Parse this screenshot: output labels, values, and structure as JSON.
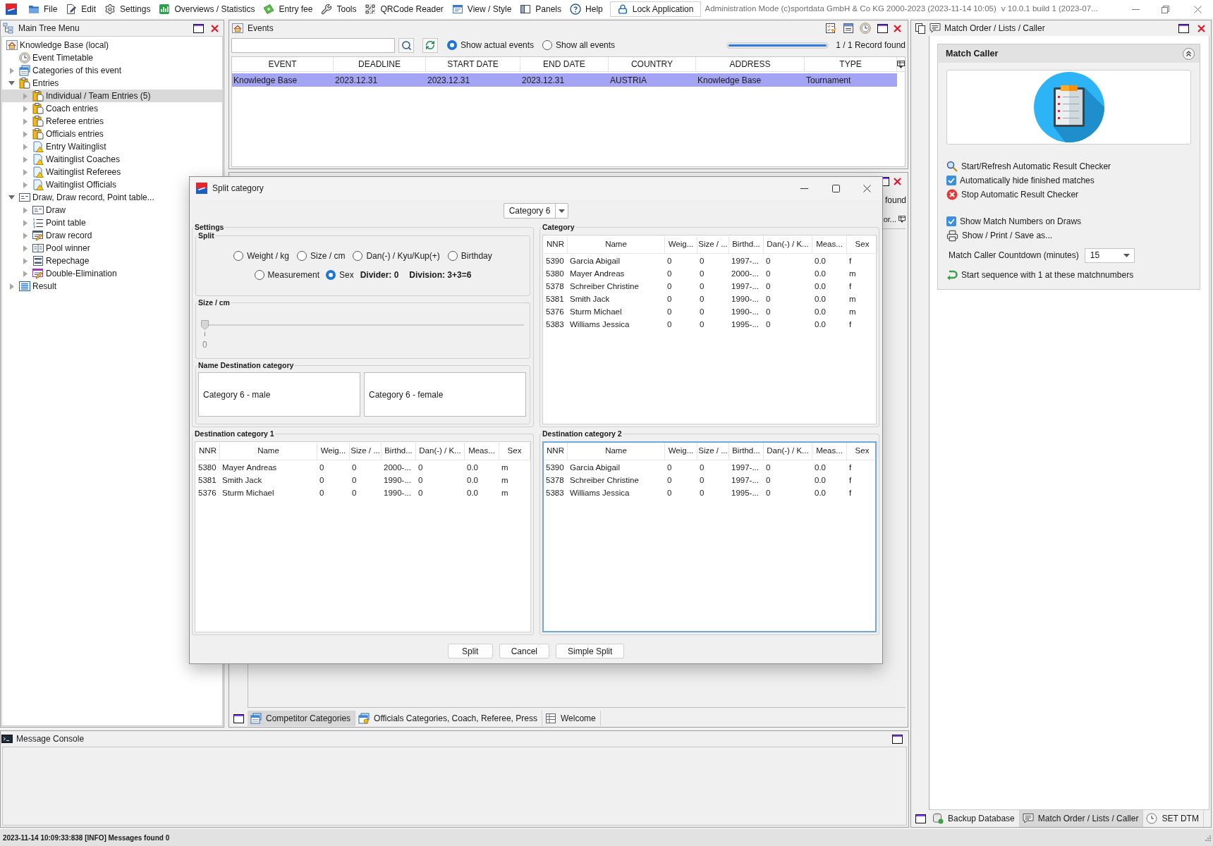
{
  "menu_bar": {
    "items": [
      "File",
      "Edit",
      "Settings",
      "Overviews / Statistics",
      "Entry fee",
      "Tools",
      "QRCode Reader",
      "View / Style",
      "Panels",
      "Help"
    ],
    "lock_button": "Lock Application",
    "title": "Administration Mode (c)sportdata GmbH & Co KG 2000-2023 (2023-11-14 10:05)",
    "version": "v 10.0.1 build 1 (2023-07..."
  },
  "tree_panel": {
    "title": "Main Tree Menu",
    "items": [
      {
        "label": "Knowledge Base (local)",
        "kind": "home",
        "selected": false,
        "children": [
          {
            "label": "Event Timetable",
            "kind": "clock",
            "selected": false
          },
          {
            "label": "Categories of this event",
            "kind": "categories",
            "selected": false,
            "expanded": false
          },
          {
            "label": "Entries",
            "kind": "entries",
            "selected": false,
            "expanded": true,
            "children": [
              {
                "label": "Individual / Team Entries (5)",
                "kind": "entries",
                "selected": true,
                "expanded": false
              },
              {
                "label": "Coach entries",
                "kind": "entries",
                "selected": false,
                "expanded": false
              },
              {
                "label": "Referee entries",
                "kind": "entries",
                "selected": false,
                "expanded": false
              },
              {
                "label": "Officials entries",
                "kind": "entries",
                "selected": false,
                "expanded": false
              },
              {
                "label": "Entry Waitinglist",
                "kind": "waitinglist",
                "selected": false,
                "expanded": false
              },
              {
                "label": "Waitinglist Coaches",
                "kind": "waitinglist",
                "selected": false,
                "expanded": false
              },
              {
                "label": "Waitinglist Referees",
                "kind": "waitinglist",
                "selected": false,
                "expanded": false
              },
              {
                "label": "Waitinglist Officials",
                "kind": "waitinglist",
                "selected": false,
                "expanded": false
              }
            ]
          },
          {
            "label": "Draw, Draw record, Point table...",
            "kind": "draw",
            "selected": false,
            "expanded": true,
            "children": [
              {
                "label": "Draw",
                "kind": "draw",
                "selected": false,
                "expanded": false
              },
              {
                "label": "Point table",
                "kind": "pointtable",
                "selected": false,
                "expanded": false
              },
              {
                "label": "Draw record",
                "kind": "drawrecord",
                "selected": false,
                "expanded": false
              },
              {
                "label": "Pool winner",
                "kind": "poolwinner",
                "selected": false,
                "expanded": false
              },
              {
                "label": "Repechage",
                "kind": "repechage",
                "selected": false,
                "expanded": false
              },
              {
                "label": "Double-Elimination",
                "kind": "doubleelim",
                "selected": false,
                "expanded": false
              }
            ]
          },
          {
            "label": "Result",
            "kind": "result",
            "selected": false,
            "expanded": false
          }
        ]
      }
    ]
  },
  "events_panel": {
    "title": "Events",
    "filters": [
      {
        "label": "Show actual events",
        "selected": true
      },
      {
        "label": "Show all events",
        "selected": false
      }
    ],
    "progress": {
      "level": 1
    },
    "record_count": "1 / 1 Record found",
    "table": {
      "columns": [
        "EVENT",
        "DEADLINE",
        "START DATE",
        "END DATE",
        "COUNTRY",
        "ADDRESS",
        "TYPE"
      ],
      "rows": [
        {
          "cells": [
            "Knowledge Base",
            "2023.12.31",
            "2023.12.31",
            "2023.12.31",
            "AUSTRIA",
            "Knowledge Base",
            "Tournament"
          ],
          "selected": true
        }
      ]
    }
  },
  "categories_panel": {
    "record_count": "found",
    "column_header": "or...",
    "tabs": [
      {
        "label": "Competitor Categories",
        "selected": true
      },
      {
        "label": "Officials Categories, Coach, Referee, Press",
        "selected": false
      },
      {
        "label": "Welcome",
        "selected": false
      }
    ]
  },
  "dialog": {
    "title": "Split category",
    "category_select": {
      "value": "Category 6"
    },
    "settings": {
      "title": "Settings",
      "split": {
        "title": "Split",
        "options": [
          {
            "label": "Weight / kg",
            "selected": false
          },
          {
            "label": "Size / cm",
            "selected": false
          },
          {
            "label": "Dan(-) / Kyu/Kup(+)",
            "selected": false
          },
          {
            "label": "Birthday",
            "selected": false
          },
          {
            "label": "Measurement",
            "selected": false
          },
          {
            "label": "Sex",
            "selected": true
          }
        ],
        "divider": "Divider: 0",
        "division": "Division: 3+3=6"
      },
      "size": {
        "title": "Size / cm",
        "slider": {
          "level": 0
        },
        "tick_label": "0"
      },
      "names": {
        "title": "Name Destination category",
        "fields": [
          {
            "value": "Category 6 - male"
          },
          {
            "value": "Category 6 - female"
          }
        ]
      }
    },
    "category": {
      "title": "Category",
      "focused": false,
      "columns": [
        "NNR",
        "Name",
        "Weig...",
        "Size / ...",
        "Birthd...",
        "Dan(-) / K...",
        "Meas...",
        "Sex"
      ],
      "rows": [
        {
          "cells": [
            "5390",
            "Garcia Abigail",
            "0",
            "0",
            "1997-...",
            "0",
            "0.0",
            "f"
          ],
          "selected": false
        },
        {
          "cells": [
            "5380",
            "Mayer Andreas",
            "0",
            "0",
            "2000-...",
            "0",
            "0.0",
            "m"
          ],
          "selected": false
        },
        {
          "cells": [
            "5378",
            "Schreiber Christine",
            "0",
            "0",
            "1997-...",
            "0",
            "0.0",
            "f"
          ],
          "selected": false
        },
        {
          "cells": [
            "5381",
            "Smith Jack",
            "0",
            "0",
            "1990-...",
            "0",
            "0.0",
            "m"
          ],
          "selected": false
        },
        {
          "cells": [
            "5376",
            "Sturm Michael",
            "0",
            "0",
            "1990-...",
            "0",
            "0.0",
            "m"
          ],
          "selected": false
        },
        {
          "cells": [
            "5383",
            "Williams Jessica",
            "0",
            "0",
            "1995-...",
            "0",
            "0.0",
            "f"
          ],
          "selected": false
        }
      ]
    },
    "destination_1": {
      "title": "Destination category 1",
      "focused": false,
      "columns": [
        "NNR",
        "Name",
        "Weig...",
        "Size / ...",
        "Birthd...",
        "Dan(-) / K...",
        "Meas...",
        "Sex"
      ],
      "rows": [
        {
          "cells": [
            "5380",
            "Mayer Andreas",
            "0",
            "0",
            "2000-...",
            "0",
            "0.0",
            "m"
          ],
          "selected": false
        },
        {
          "cells": [
            "5381",
            "Smith Jack",
            "0",
            "0",
            "1990-...",
            "0",
            "0.0",
            "m"
          ],
          "selected": false
        },
        {
          "cells": [
            "5376",
            "Sturm Michael",
            "0",
            "0",
            "1990-...",
            "0",
            "0.0",
            "m"
          ],
          "selected": false
        }
      ]
    },
    "destination_2": {
      "title": "Destination category 2",
      "focused": true,
      "columns": [
        "NNR",
        "Name",
        "Weig...",
        "Size / ...",
        "Birthd...",
        "Dan(-) / K...",
        "Meas...",
        "Sex"
      ],
      "rows": [
        {
          "cells": [
            "5390",
            "Garcia Abigail",
            "0",
            "0",
            "1997-...",
            "0",
            "0.0",
            "f"
          ],
          "selected": false
        },
        {
          "cells": [
            "5378",
            "Schreiber Christine",
            "0",
            "0",
            "1997-...",
            "0",
            "0.0",
            "f"
          ],
          "selected": false
        },
        {
          "cells": [
            "5383",
            "Williams Jessica",
            "0",
            "0",
            "1995-...",
            "0",
            "0.0",
            "f"
          ],
          "selected": false
        }
      ]
    },
    "buttons": [
      "Split",
      "Cancel",
      "Simple Split"
    ]
  },
  "caller_panel": {
    "title": "Match Order / Lists / Caller",
    "section": {
      "title": "Match Caller",
      "expanded": true,
      "actions": [
        {
          "kind": "search",
          "label": "Start/Refresh Automatic Result Checker"
        },
        {
          "kind": "checkbox",
          "label": "Automatically hide finished matches",
          "checked": true
        },
        {
          "kind": "stop",
          "label": "Stop Automatic Result Checker"
        }
      ],
      "display_options": [
        {
          "kind": "checkbox",
          "label": "Show Match Numbers on Draws",
          "checked": true
        },
        {
          "kind": "print",
          "label": "Show / Print / Save as..."
        }
      ],
      "countdown": {
        "label": "Match Caller Countdown (minutes)",
        "value": "15"
      },
      "sequence": {
        "label": "Start sequence with 1 at these matchnumbers"
      }
    },
    "tabs": [
      {
        "label": "Backup Database",
        "selected": false
      },
      {
        "label": "Match Order / Lists / Caller",
        "selected": true
      },
      {
        "label": "SET DTM",
        "selected": false
      }
    ]
  },
  "message_console": {
    "title": "Message Console"
  },
  "status_bar": {
    "text": "2023-11-14 10:09:33:838 [INFO] Messages found 0"
  }
}
